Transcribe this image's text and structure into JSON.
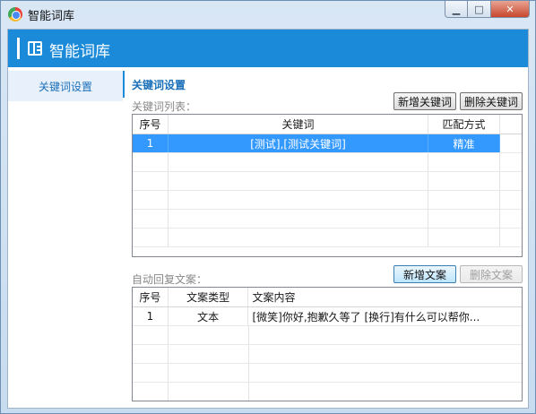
{
  "window": {
    "title": "智能词库",
    "controls": {
      "minimize": "▁",
      "maximize": "□",
      "close": "✕"
    }
  },
  "header": {
    "title": "智能词库"
  },
  "sidebar": {
    "items": [
      {
        "label": "关键词设置"
      }
    ]
  },
  "main": {
    "section_title": "关键词设置",
    "keywords": {
      "label": "关键词列表：",
      "add_button": "新增关键词",
      "delete_button": "删除关键词",
      "columns": [
        "序号",
        "关键词",
        "匹配方式"
      ],
      "rows": [
        {
          "index": "1",
          "keyword": "[测试],[测试关键词]",
          "match": "精准"
        }
      ]
    },
    "replies": {
      "label": "自动回复文案：",
      "add_button": "新增文案",
      "delete_button": "删除文案",
      "columns": [
        "序号",
        "文案类型",
        "文案内容"
      ],
      "rows": [
        {
          "index": "1",
          "type": "文本",
          "content": "[微笑]你好,抱歉久等了    [换行]有什么可以帮你..."
        }
      ]
    }
  },
  "colors": {
    "accent": "#1a8ad9",
    "selection": "#3399ff"
  }
}
